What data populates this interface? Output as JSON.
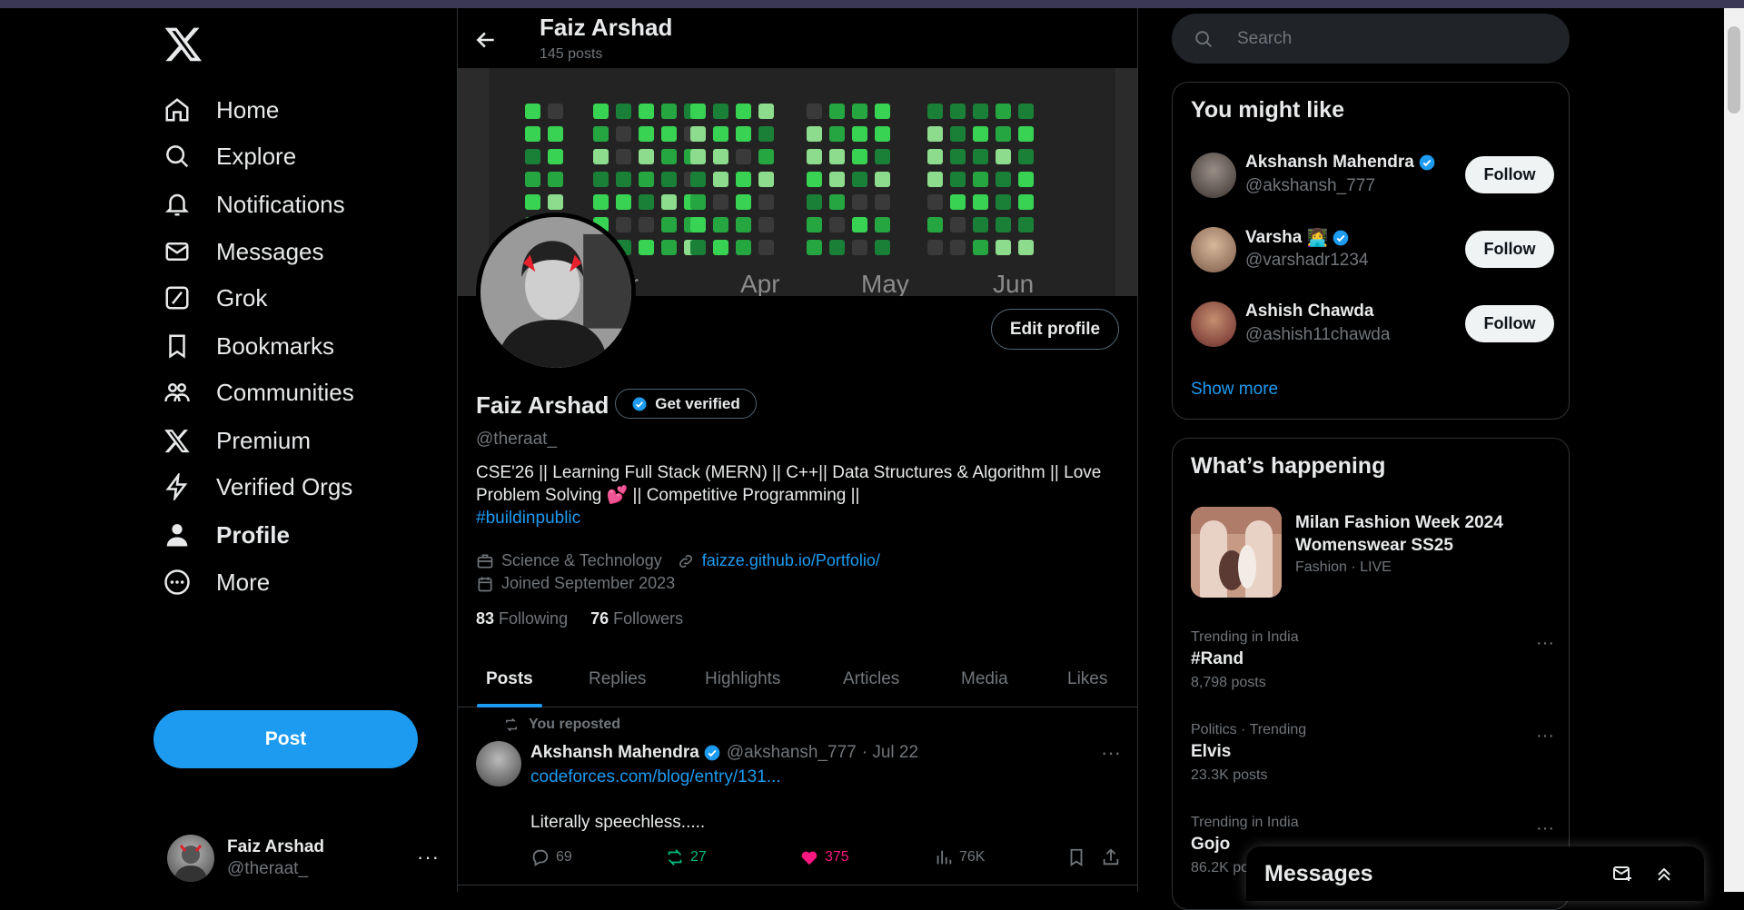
{
  "nav": {
    "items": [
      {
        "label": "Home",
        "icon": "home-icon"
      },
      {
        "label": "Explore",
        "icon": "search-icon"
      },
      {
        "label": "Notifications",
        "icon": "bell-icon"
      },
      {
        "label": "Messages",
        "icon": "mail-icon"
      },
      {
        "label": "Grok",
        "icon": "grok-icon"
      },
      {
        "label": "Bookmarks",
        "icon": "bookmark-icon"
      },
      {
        "label": "Communities",
        "icon": "communities-icon"
      },
      {
        "label": "Premium",
        "icon": "x-logo-icon"
      },
      {
        "label": "Verified Orgs",
        "icon": "lightning-icon"
      },
      {
        "label": "Profile",
        "icon": "person-icon"
      },
      {
        "label": "More",
        "icon": "more-circle-icon"
      }
    ],
    "post_label": "Post",
    "account": {
      "name": "Faiz Arshad",
      "handle": "@theraat_",
      "more": "···"
    }
  },
  "header": {
    "title": "Faiz Arshad",
    "subtitle": "145 posts"
  },
  "banner": {
    "months": [
      "ar",
      "Apr",
      "May",
      "Jun"
    ]
  },
  "profile": {
    "edit_label": "Edit profile",
    "name": "Faiz Arshad",
    "get_verified": "Get verified",
    "handle": "@theraat_",
    "bio_line1": "CSE'26 || Learning Full Stack (MERN) || C++|| Data Structures & Algorithm || Love",
    "bio_line2": "Problem Solving 💕 || Competitive Programming ||",
    "bio_tag": "#buildinpublic",
    "category": "Science & Technology",
    "website": "faizze.github.io/Portfolio/",
    "joined": "Joined September 2023",
    "following_count": "83",
    "following_label": "Following",
    "followers_count": "76",
    "followers_label": "Followers"
  },
  "tabs": [
    "Posts",
    "Replies",
    "Highlights",
    "Articles",
    "Media",
    "Likes"
  ],
  "tweet": {
    "repost_label": "You reposted",
    "author": "Akshansh Mahendra",
    "handle": "@akshansh_777",
    "date": "· Jul 22",
    "link": "codeforces.com/blog/entry/131...",
    "text": "Literally speechless.....",
    "replies": "69",
    "retweets": "27",
    "likes": "375",
    "views": "76K",
    "more": "···"
  },
  "sidebar": {
    "search_placeholder": "Search",
    "might_like": {
      "title": "You might like",
      "users": [
        {
          "name": "Akshansh Mahendra",
          "handle": "@akshansh_777",
          "emoji": ""
        },
        {
          "name": "Varsha",
          "handle": "@varshadr1234",
          "emoji": "👩‍💻"
        },
        {
          "name": "Ashish Chawda",
          "handle": "@ashish11chawda",
          "emoji": ""
        }
      ],
      "follow_label": "Follow",
      "show_more": "Show more"
    },
    "happening": {
      "title": "What’s happening",
      "news": {
        "title": "Milan Fashion Week 2024 Womenswear SS25",
        "meta": "Fashion · LIVE"
      },
      "trends": [
        {
          "context": "Trending in India",
          "title": "#Rand",
          "count": "8,798 posts"
        },
        {
          "context": "Politics · Trending",
          "title": "Elvis",
          "count": "23.3K posts"
        },
        {
          "context": "Trending in India",
          "title": "Gojo",
          "count": "86.2K posts"
        }
      ],
      "dots": "···"
    }
  },
  "messages_drawer": {
    "title": "Messages"
  },
  "colors": {
    "accent": "#1d9bf0",
    "like": "#f91880",
    "retweet": "#00ba7c",
    "border": "#2f3336",
    "muted": "#71767b"
  }
}
